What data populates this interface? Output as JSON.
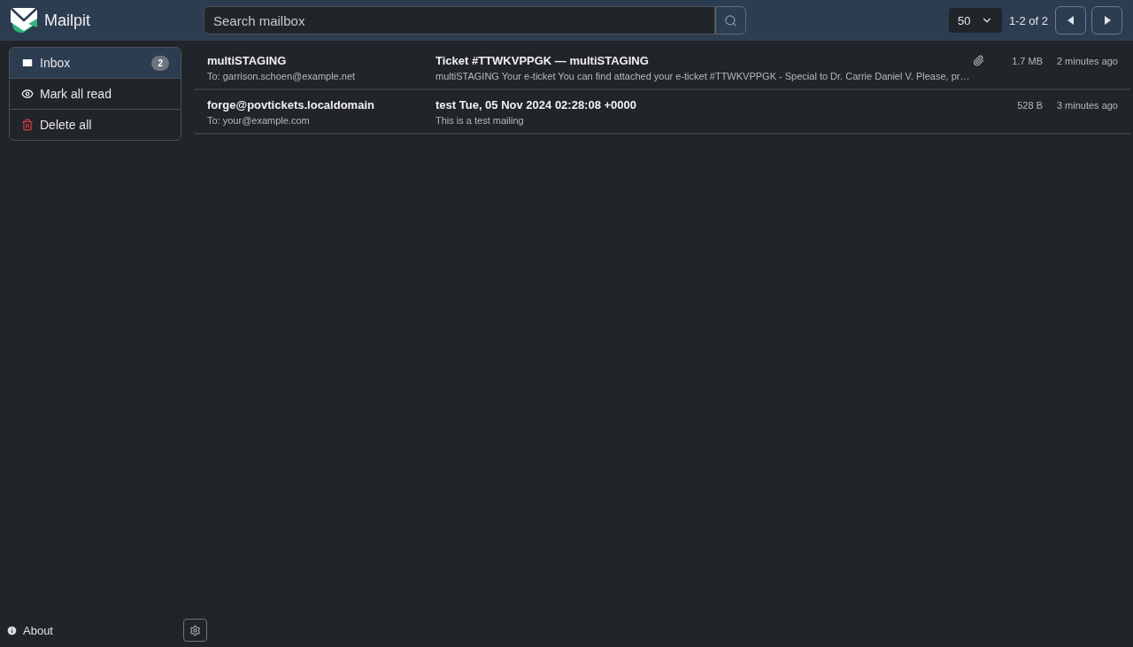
{
  "app": {
    "name": "Mailpit"
  },
  "search": {
    "placeholder": "Search mailbox"
  },
  "pagination": {
    "per_page": "50",
    "range": "1-2 of 2"
  },
  "sidebar": {
    "items": [
      {
        "kind": "inbox",
        "label": "Inbox",
        "count": "2",
        "selected": true
      },
      {
        "kind": "read",
        "label": "Mark all read",
        "selected": false
      },
      {
        "kind": "delete",
        "label": "Delete all",
        "selected": false
      }
    ],
    "about": "About"
  },
  "messages": [
    {
      "from": "multiSTAGING",
      "to": "To: garrison.schoen@example.net",
      "subject": "Ticket #TTWKVPPGK — multiSTAGING",
      "snippet": "multiSTAGING Your e-ticket You can find attached your e-ticket #TTWKVPPGK - Special to Dr. Carrie Daniel V. Please, pr…",
      "attachment": true,
      "size": "1.7 MB",
      "time": "2 minutes ago"
    },
    {
      "from": "forge@povtickets.localdomain",
      "to": "To: your@example.com",
      "subject": "test Tue, 05 Nov 2024 02:28:08 +0000",
      "snippet": "This is a test mailing",
      "attachment": false,
      "size": "528 B",
      "time": "3 minutes ago"
    }
  ]
}
